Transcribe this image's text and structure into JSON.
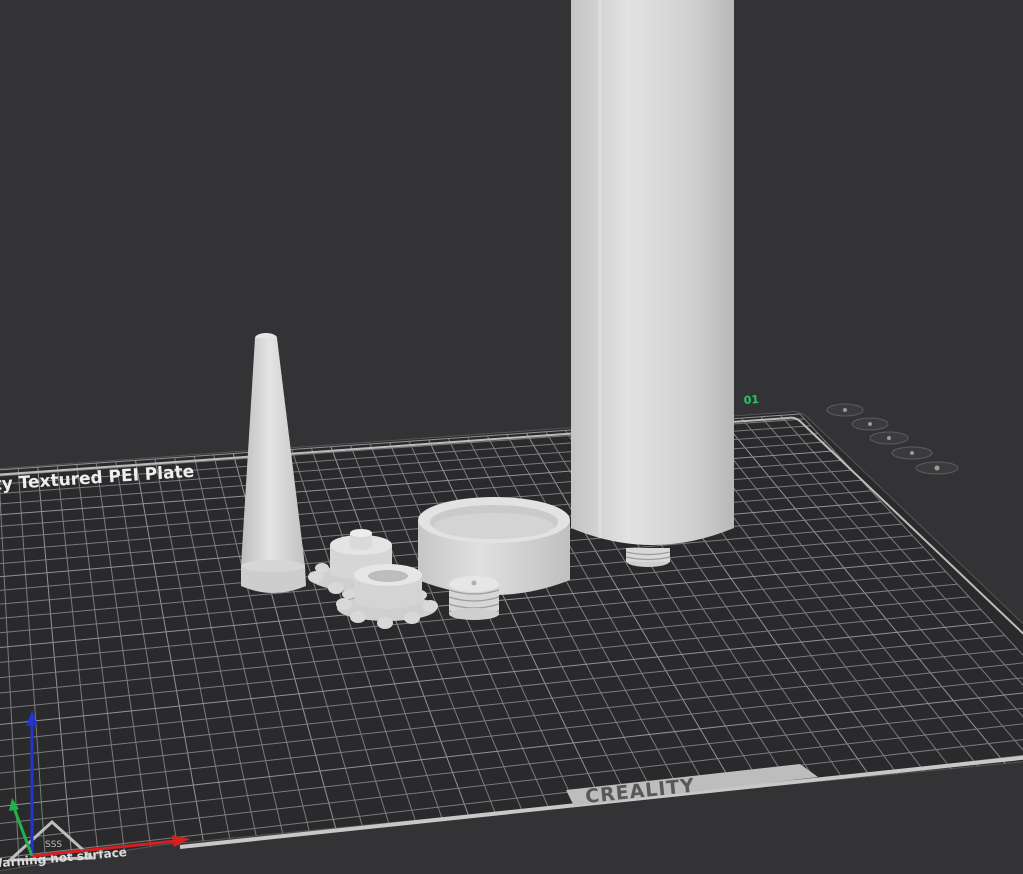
{
  "bed": {
    "plate_label": "ty Textured PEI Plate",
    "plate_number": "01",
    "brand_logo": "CREALITY",
    "warning_text": "Warning hot surface",
    "warning_symbol": "SSS"
  },
  "colors": {
    "background": "#333335",
    "bed": "#2a2a2c",
    "grid": "#8a8a8c",
    "model": "#d6d6d6",
    "plate_number": "#29c66a",
    "axis_x": "#d32020",
    "axis_y": "#22b14c",
    "axis_z": "#2334c8"
  },
  "axes": {
    "x": "x-axis",
    "y": "y-axis",
    "z": "z-axis"
  }
}
